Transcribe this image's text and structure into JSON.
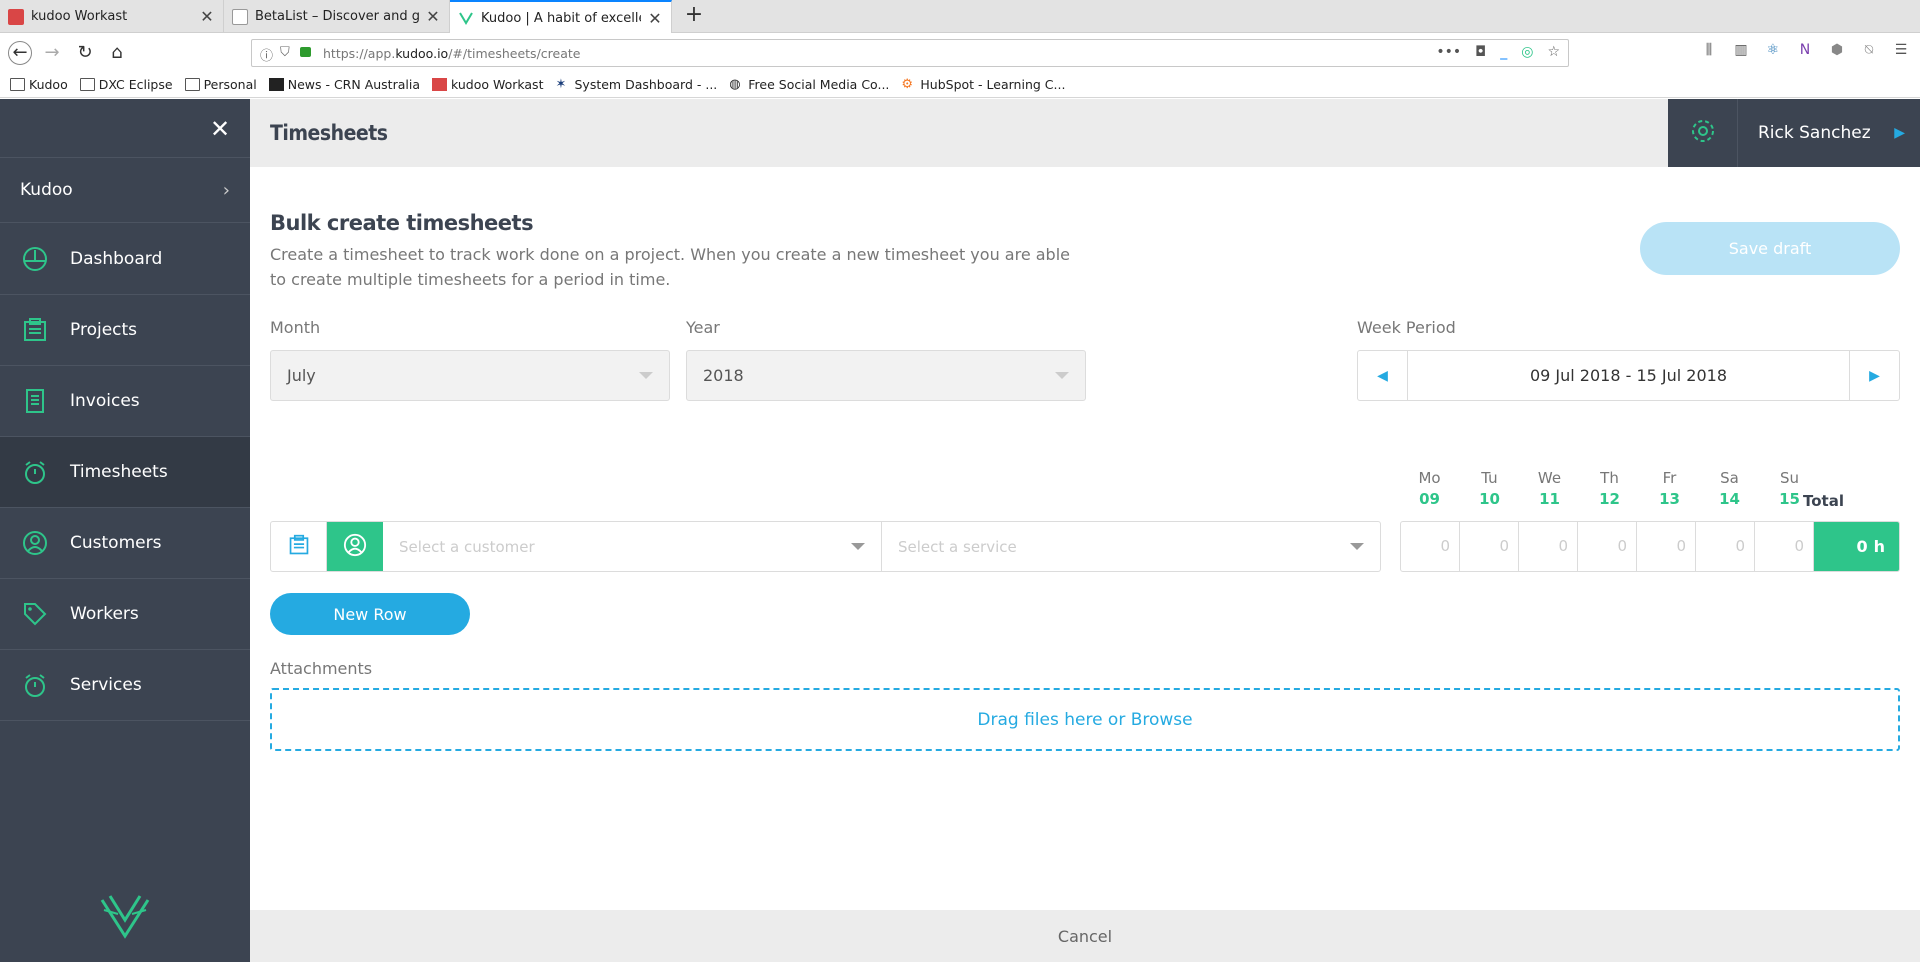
{
  "browser": {
    "tabs": [
      {
        "title": "kudoo Workast",
        "color": "#d94646",
        "active": false
      },
      {
        "title": "BetaList – Discover and get ea",
        "color": "#888888",
        "active": false
      },
      {
        "title": "Kudoo | A habit of excellence",
        "color": "#2ec58a",
        "active": true
      }
    ],
    "url_prefix": "https://app.",
    "url_host": "kudoo.io",
    "url_path": "/#/timesheets/create",
    "bookmarks": [
      "Kudoo",
      "DXC Eclipse",
      "Personal",
      "News - CRN Australia",
      "kudoo Workast",
      "System Dashboard - ...",
      "Free Social Media Co...",
      "HubSpot - Learning C..."
    ]
  },
  "sidebar": {
    "org_name": "Kudoo",
    "items": [
      {
        "label": "Dashboard",
        "icon": "dashboard-icon"
      },
      {
        "label": "Projects",
        "icon": "clipboard-icon"
      },
      {
        "label": "Invoices",
        "icon": "invoice-icon"
      },
      {
        "label": "Timesheets",
        "icon": "stopwatch-icon",
        "active": true
      },
      {
        "label": "Customers",
        "icon": "user-circle-icon"
      },
      {
        "label": "Workers",
        "icon": "tag-icon"
      },
      {
        "label": "Services",
        "icon": "stopwatch-icon"
      }
    ]
  },
  "header": {
    "title": "Timesheets",
    "user_name": "Rick Sanchez"
  },
  "form": {
    "heading": "Bulk create timesheets",
    "description": "Create a timesheet to track work done on a project. When you create a new timesheet you are able to create multiple timesheets for a period in time.",
    "save_draft_label": "Save draft",
    "month_label": "Month",
    "month_value": "July",
    "year_label": "Year",
    "year_value": "2018",
    "week_label": "Week Period",
    "week_value": "09 Jul 2018 - 15 Jul 2018",
    "days": [
      {
        "name": "Mo",
        "date": "09"
      },
      {
        "name": "Tu",
        "date": "10"
      },
      {
        "name": "We",
        "date": "11"
      },
      {
        "name": "Th",
        "date": "12"
      },
      {
        "name": "Fr",
        "date": "13"
      },
      {
        "name": "Sa",
        "date": "14"
      },
      {
        "name": "Su",
        "date": "15"
      }
    ],
    "total_label": "Total",
    "customer_placeholder": "Select a customer",
    "service_placeholder": "Select a service",
    "hours": [
      "0",
      "0",
      "0",
      "0",
      "0",
      "0",
      "0"
    ],
    "total_value": "0",
    "total_unit": "h",
    "new_row_label": "New Row",
    "attachments_label": "Attachments",
    "dropzone_text": "Drag files here or Browse"
  },
  "footer": {
    "cancel_label": "Cancel"
  },
  "colors": {
    "sidebar_bg": "#3c4451",
    "accent_green": "#2ec58a",
    "accent_blue": "#25aae1"
  }
}
